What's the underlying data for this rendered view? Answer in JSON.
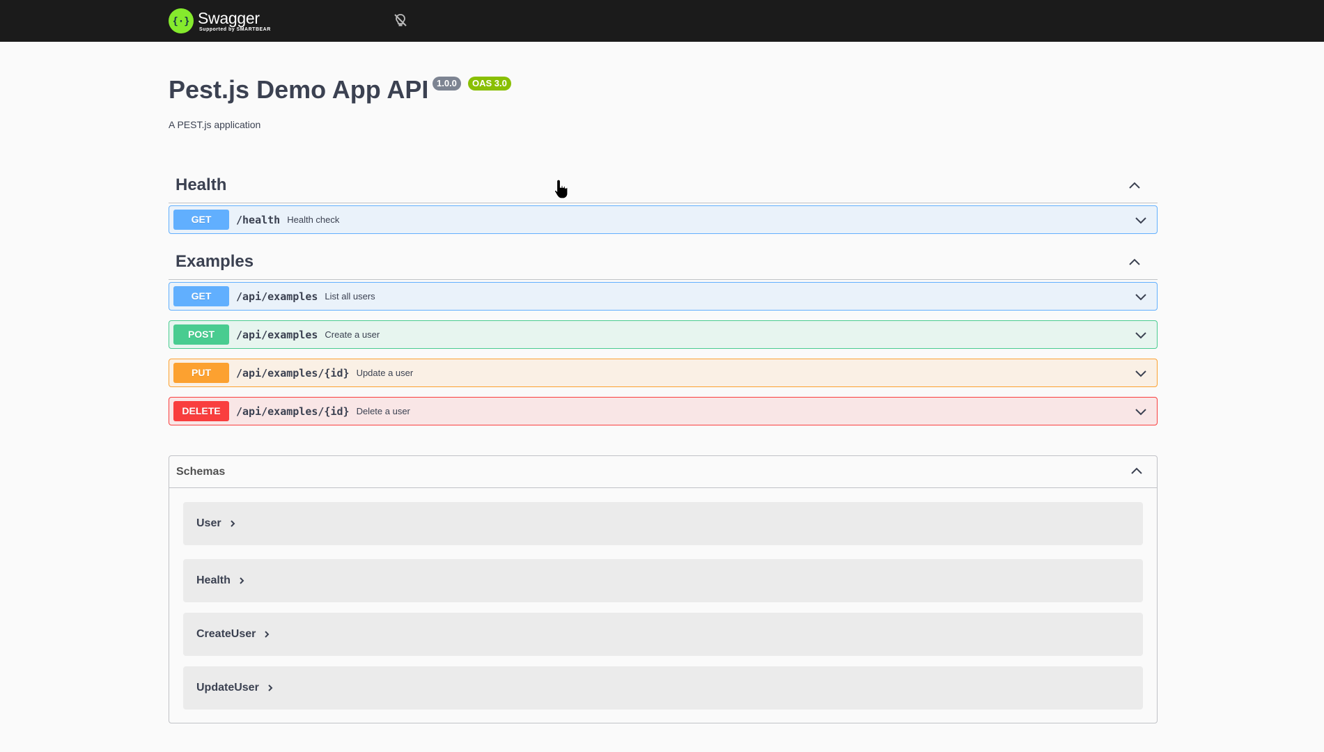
{
  "topbar": {
    "logo_name": "Swagger",
    "logo_sub": "Supported by SMARTBEAR",
    "logo_icon": "swagger-logo-icon",
    "theme_icon": "lightbulb-off-icon"
  },
  "info": {
    "title": "Pest.js Demo App API",
    "version": "1.0.0",
    "oas": "OAS 3.0",
    "description": "A PEST.js application"
  },
  "tags": [
    {
      "name": "Health",
      "operations": [
        {
          "method": "GET",
          "path": "/health",
          "summary": "Health check"
        }
      ]
    },
    {
      "name": "Examples",
      "operations": [
        {
          "method": "GET",
          "path": "/api/examples",
          "summary": "List all users"
        },
        {
          "method": "POST",
          "path": "/api/examples",
          "summary": "Create a user"
        },
        {
          "method": "PUT",
          "path": "/api/examples/{id}",
          "summary": "Update a user"
        },
        {
          "method": "DELETE",
          "path": "/api/examples/{id}",
          "summary": "Delete a user"
        }
      ]
    }
  ],
  "schemas": {
    "title": "Schemas",
    "items": [
      {
        "name": "User"
      },
      {
        "name": "Health"
      },
      {
        "name": "CreateUser"
      },
      {
        "name": "UpdateUser"
      }
    ]
  },
  "colors": {
    "get": "#61affe",
    "post": "#49cc90",
    "put": "#fca130",
    "delete": "#f93e3e",
    "topbar": "#1b1b1b",
    "logo": "#85ea2d"
  }
}
